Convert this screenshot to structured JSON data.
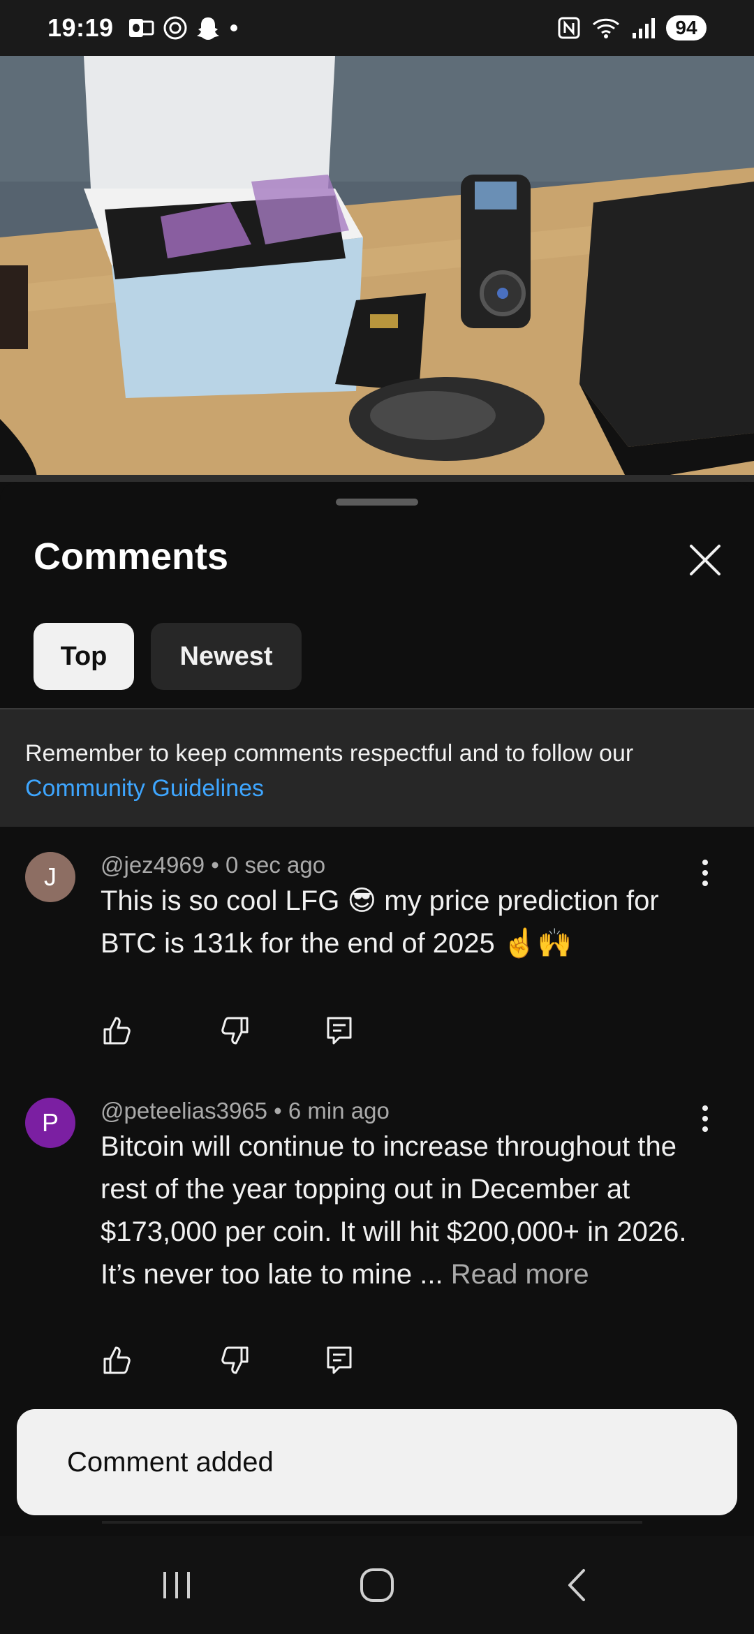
{
  "status_bar": {
    "time": "19:19",
    "battery": "94",
    "left_icons": [
      "outlook-icon",
      "threads-icon",
      "snapchat-icon",
      "dot-icon"
    ],
    "right_icons": [
      "nfc-icon",
      "wifi-icon",
      "signal-icon"
    ]
  },
  "video": {
    "description_icons": "video-thumbnail"
  },
  "comments_panel": {
    "title": "Comments",
    "close_icon": "close-icon",
    "tabs": [
      {
        "label": "Top",
        "selected": true
      },
      {
        "label": "Newest",
        "selected": false
      }
    ],
    "notice": {
      "text": "Remember to keep comments respectful and to follow our",
      "link": "Community Guidelines"
    },
    "comments": [
      {
        "avatar_letter": "J",
        "avatar_color": "#8d6e63",
        "meta": "@jez4969 • 0 sec ago",
        "text": "This is so cool LFG 😎 my price prediction for BTC is 131k for the end of 2025 ☝️🙌",
        "read_more": ""
      },
      {
        "avatar_letter": "P",
        "avatar_color": "#7b1fa2",
        "meta": "@peteelias3965 • 6 min ago",
        "text": "Bitcoin will continue to increase throughout the rest of the year topping out in December at $173,000 per coin. It will hit $200,000+ in 2026. It’s never too late to mine ...",
        "read_more": "Read more"
      }
    ]
  },
  "toast": {
    "text": "Comment added"
  },
  "nav_bar": {
    "icons": [
      "recent-apps-icon",
      "home-icon",
      "back-icon"
    ]
  },
  "colors": {
    "background": "#0f0f0f",
    "link": "#3ea6ff",
    "chip_selected": "#f1f1f1",
    "chip": "#272727"
  }
}
